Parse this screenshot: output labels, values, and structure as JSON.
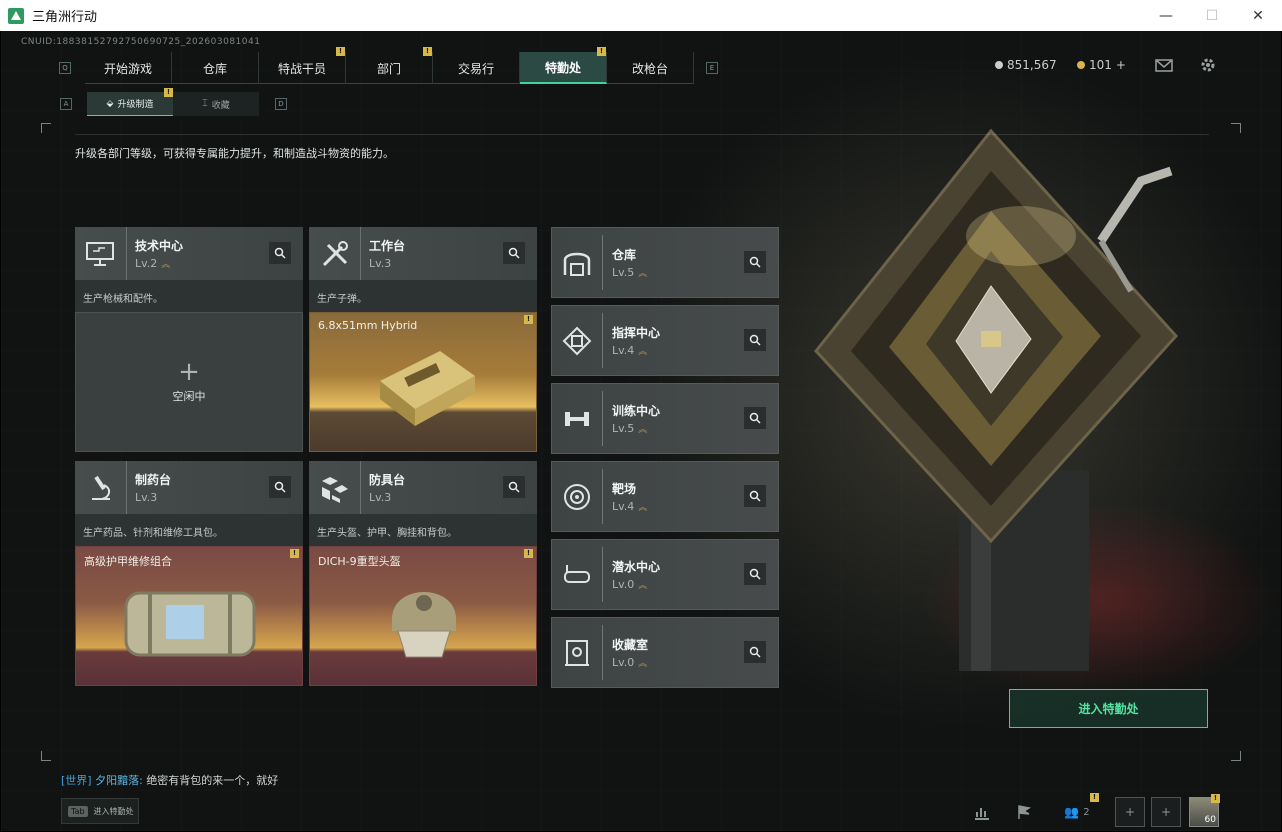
{
  "window": {
    "title": "三角洲行动",
    "minimize": "—",
    "maximize": "☐",
    "close": "✕"
  },
  "uid": "CNUID:18838152792750690725_202603081041",
  "nav": {
    "key_left": "Q",
    "key_right": "E",
    "tabs": [
      "开始游戏",
      "仓库",
      "特战干员",
      "部门",
      "交易行",
      "特勤处",
      "改枪台"
    ]
  },
  "currency": {
    "silver": "851,567",
    "gold": "101",
    "gold_plus": "+"
  },
  "subnav": {
    "key_left": "A",
    "key_right": "D",
    "tabs": [
      "升级制造",
      "收藏"
    ]
  },
  "description": "升级各部门等级，可获得专属能力提升，和制造战斗物资的能力。",
  "workshops": [
    {
      "name": "技术中心",
      "level": "Lv.2",
      "desc": "生产枪械和配件。",
      "slot_state": "空闲中",
      "slot_plus": "+"
    },
    {
      "name": "工作台",
      "level": "Lv.3",
      "desc": "生产子弹。",
      "slot_item": "6.8x51mm Hybrid"
    },
    {
      "name": "制药台",
      "level": "Lv.3",
      "desc": "生产药品、针剂和维修工具包。",
      "slot_item": "高级护甲维修组合"
    },
    {
      "name": "防具台",
      "level": "Lv.3",
      "desc": "生产头盔、护甲、胸挂和背包。",
      "slot_item": "DICH-9重型头盔"
    }
  ],
  "facilities": [
    {
      "name": "仓库",
      "level": "Lv.5"
    },
    {
      "name": "指挥中心",
      "level": "Lv.4"
    },
    {
      "name": "训练中心",
      "level": "Lv.5"
    },
    {
      "name": "靶场",
      "level": "Lv.4"
    },
    {
      "name": "潜水中心",
      "level": "Lv.0"
    },
    {
      "name": "收藏室",
      "level": "Lv.0"
    }
  ],
  "enter_button": "进入特勤处",
  "chat": {
    "channel": "[世界]",
    "user": "夕阳黯落:",
    "message": "绝密有背包的来一个，就好"
  },
  "tab_hint": {
    "key": "Tab",
    "label": "进入特勤处"
  },
  "bottom": {
    "friends_count": "2",
    "player_level": "60",
    "rank_marker": "!"
  },
  "colors": {
    "accent": "#41d39b",
    "badge": "#d9b84a",
    "level_arrow": "#b09a55"
  }
}
